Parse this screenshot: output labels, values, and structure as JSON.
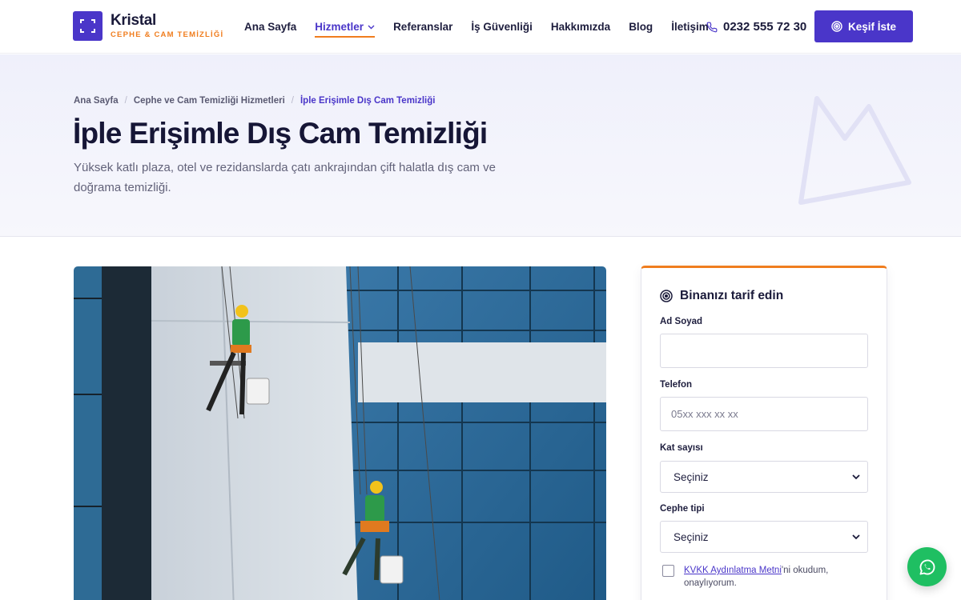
{
  "brand": {
    "name": "Kristal",
    "tagline": "CEPHE & CAM TEMİZLİĞİ"
  },
  "nav": {
    "items": [
      {
        "label": "Ana Sayfa"
      },
      {
        "label": "Hizmetler"
      },
      {
        "label": "Referanslar"
      },
      {
        "label": "İş Güvenliği"
      },
      {
        "label": "Hakkımızda"
      },
      {
        "label": "Blog"
      },
      {
        "label": "İletişim"
      }
    ],
    "active": "Hizmetler"
  },
  "header": {
    "phone": "0232 555 72 30",
    "cta_label": "Keşif İste"
  },
  "breadcrumb": [
    "Ana Sayfa",
    "Cephe ve Cam Temizliği Hizmetleri",
    "İple Erişimle Dış Cam Temizliği"
  ],
  "hero": {
    "title": "İple Erişimle Dış Cam Temizliği",
    "description": "Yüksek katlı plaza, otel ve rezidanslarda çatı ankrajından çift halatla dış cam ve doğrama temizliği."
  },
  "form": {
    "title": "Binanızı tarif edin",
    "name_label": "Ad Soyad",
    "name_value": "",
    "phone_label": "Telefon",
    "phone_placeholder": "05xx xxx xx xx",
    "floors_label": "Kat sayısı",
    "floors_value": "Seçiniz",
    "facade_label": "Cephe tipi",
    "facade_value": "Seçiniz",
    "consent_link": "KVKK Aydınlatma Metni",
    "consent_text": "'ni okudum, onaylıyorum."
  },
  "colors": {
    "primary": "#4a36c9",
    "accent": "#f07d1e",
    "whatsapp": "#1fbf62"
  },
  "icons": {
    "logo": "focus-frame-icon",
    "phone": "phone-icon",
    "cta": "target-icon",
    "whatsapp": "whatsapp-icon"
  }
}
